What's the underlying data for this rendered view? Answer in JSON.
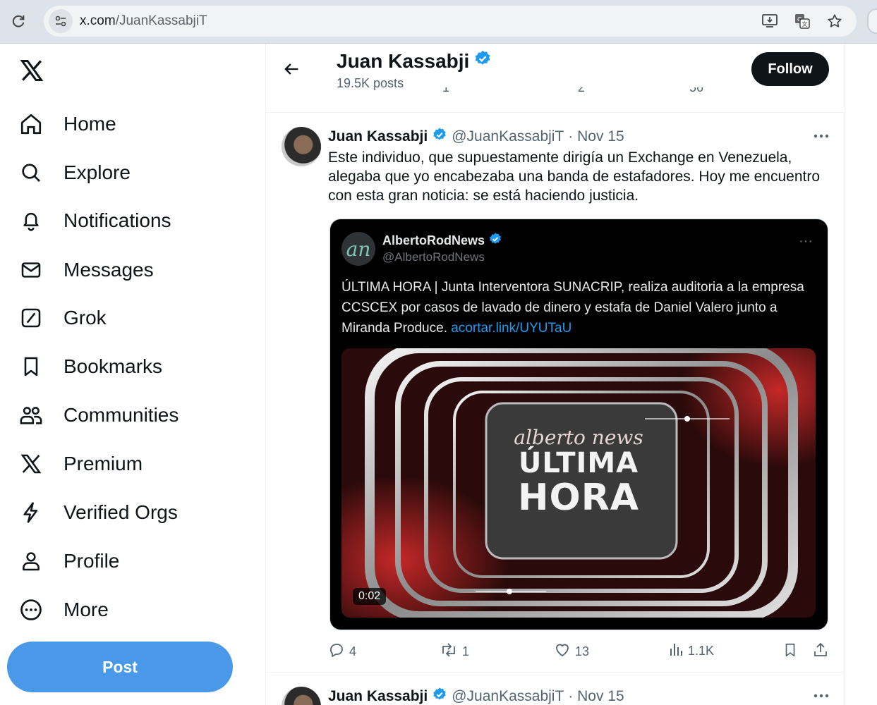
{
  "browser": {
    "url_host": "x.com",
    "url_path": "/JuanKassabjiT"
  },
  "nav": {
    "items": [
      {
        "label": "Home",
        "icon": "home-icon"
      },
      {
        "label": "Explore",
        "icon": "search-icon"
      },
      {
        "label": "Notifications",
        "icon": "bell-icon"
      },
      {
        "label": "Messages",
        "icon": "envelope-icon"
      },
      {
        "label": "Grok",
        "icon": "grok-icon"
      },
      {
        "label": "Bookmarks",
        "icon": "bookmark-icon"
      },
      {
        "label": "Communities",
        "icon": "people-icon"
      },
      {
        "label": "Premium",
        "icon": "x-icon"
      },
      {
        "label": "Verified Orgs",
        "icon": "lightning-icon"
      },
      {
        "label": "Profile",
        "icon": "person-icon"
      },
      {
        "label": "More",
        "icon": "more-circle-icon"
      }
    ],
    "post_label": "Post"
  },
  "header": {
    "name": "Juan Kassabji",
    "posts_count": "19.5K posts",
    "follow_label": "Follow",
    "partial_counts": [
      "1",
      "2",
      "56"
    ]
  },
  "tweet": {
    "name": "Juan Kassabji",
    "handle": "@JuanKassabjiT",
    "date": "· Nov 15",
    "text": "Este individuo, que supuestamente dirigía un Exchange en Venezuela, alegaba que yo encabezaba una banda de estafadores. Hoy me encuentro con esta gran noticia: se está haciendo justicia.",
    "quote": {
      "name": "AlbertoRodNews",
      "handle": "@AlbertoRodNews",
      "avatar_text": "an",
      "text": "ÚLTIMA HORA | Junta Interventora SUNACRIP, realiza auditoria a la empresa CCSCEX por casos de lavado de dinero y estafa de Daniel Valero junto a Miranda Produce.",
      "link": "acortar.link/UYUTaU",
      "media": {
        "brand": "alberto news",
        "line1": "ÚLTIMA",
        "line2": "HORA",
        "duration": "0:02"
      }
    },
    "replies": "4",
    "reposts": "1",
    "likes": "13",
    "views": "1.1K"
  },
  "next_tweet": {
    "name": "Juan Kassabji",
    "handle": "@JuanKassabjiT",
    "date": "· Nov 15"
  },
  "colors": {
    "verified": "#1d9bf0",
    "post_button": "#4a99e9",
    "follow_button": "#0f1419"
  }
}
